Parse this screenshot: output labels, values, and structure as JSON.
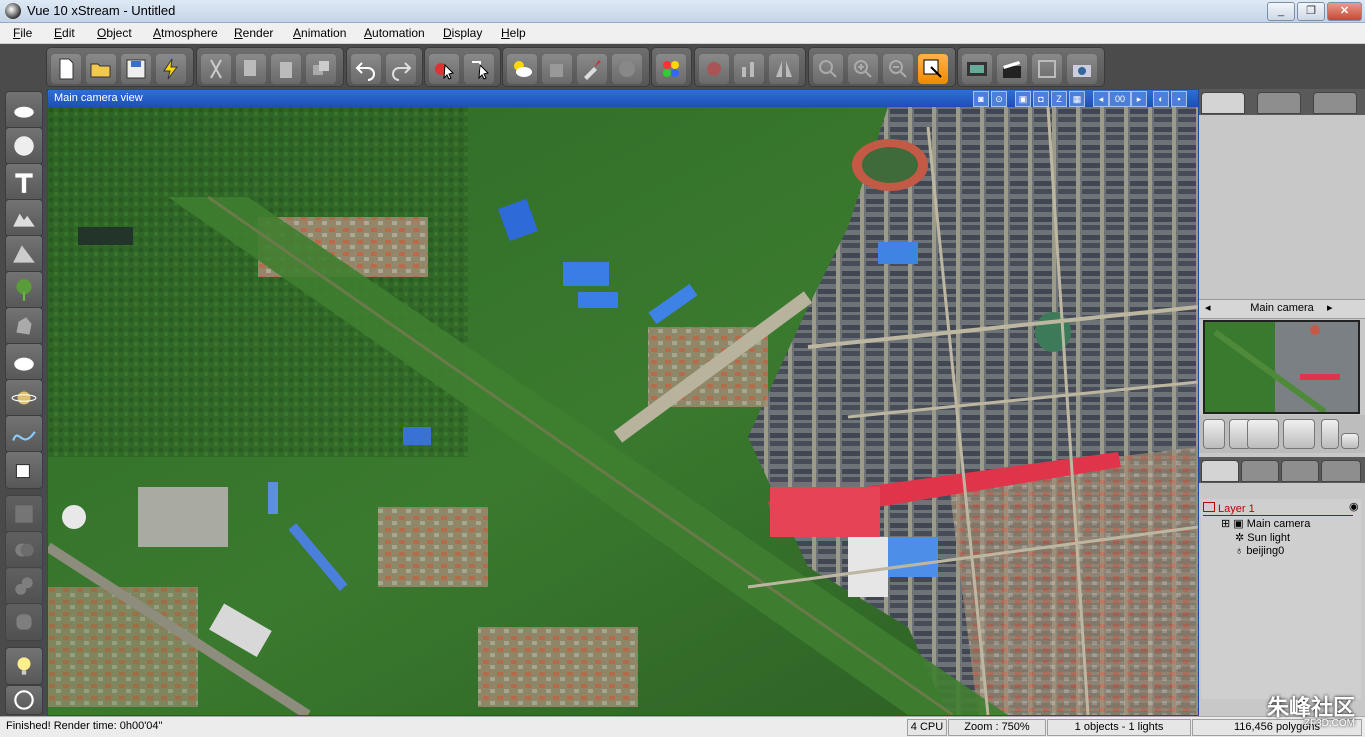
{
  "window": {
    "title": "Vue 10 xStream - Untitled",
    "minimize": "_",
    "maximize": "❐",
    "close": "✕"
  },
  "menu": [
    "File",
    "Edit",
    "Object",
    "Atmosphere",
    "Render",
    "Animation",
    "Automation",
    "Display",
    "Help"
  ],
  "viewport": {
    "title": "Main camera view",
    "frame_counter": "00"
  },
  "camera_panel": {
    "camera_name": "Main camera"
  },
  "layers": {
    "layer": "Layer 1",
    "items": [
      "Main camera",
      "Sun light",
      "beijing0"
    ]
  },
  "status": {
    "message": "Finished! Render time: 0h00'04\"",
    "cpu": "4 CPU",
    "zoom": "Zoom : 750%",
    "objects": "1 objects - 1 lights",
    "polygons": "116,456 polygons"
  },
  "watermark": {
    "text": "朱峰社区",
    "sub": "ZF3D.COM"
  },
  "colors": {
    "accent": "#ef8a00",
    "viewport_title": "#1c4fb4",
    "layer_label": "#c00000"
  }
}
